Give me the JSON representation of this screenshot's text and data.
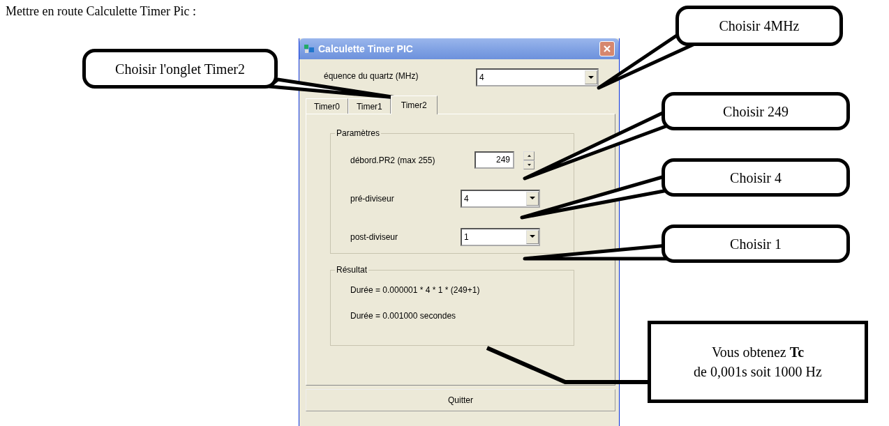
{
  "heading": "Mettre en route Calculette Timer Pic :",
  "window": {
    "title": "Calculette Timer PIC",
    "frequency": {
      "label": "équence du quartz (MHz)",
      "value": "4"
    },
    "tabs": [
      {
        "label": "Timer0",
        "selected": false
      },
      {
        "label": "Timer1",
        "selected": false
      },
      {
        "label": "Timer2",
        "selected": true
      }
    ],
    "parameters": {
      "title": "Paramètres",
      "rows": [
        {
          "kind": "spinner",
          "label": "débord.PR2 (max 255)",
          "value": "249"
        },
        {
          "kind": "dropdown",
          "label": "pré-diviseur",
          "value": "4"
        },
        {
          "kind": "dropdown",
          "label": "post-diviseur",
          "value": "1"
        }
      ]
    },
    "result": {
      "title": "Résultat",
      "lines": [
        "Durée = 0.000001 * 4 * 1 * (249+1)",
        "Durée = 0.001000 secondes"
      ]
    },
    "buttons": [
      "Quitter"
    ]
  },
  "callouts": [
    {
      "kind": "bubble",
      "lines": [
        "Choisir l'onglet Timer2"
      ]
    },
    {
      "kind": "bubble",
      "lines": [
        "Choisir 4MHz"
      ]
    },
    {
      "kind": "bubble",
      "lines": [
        "Choisir 249"
      ]
    },
    {
      "kind": "bubble",
      "lines": [
        "Choisir 4"
      ]
    },
    {
      "kind": "bubble",
      "lines": [
        "Choisir 1"
      ]
    },
    {
      "kind": "box",
      "lines": [
        "Vous obtenez **Tc**",
        "de 0,001s soit 1000 Hz"
      ]
    }
  ]
}
